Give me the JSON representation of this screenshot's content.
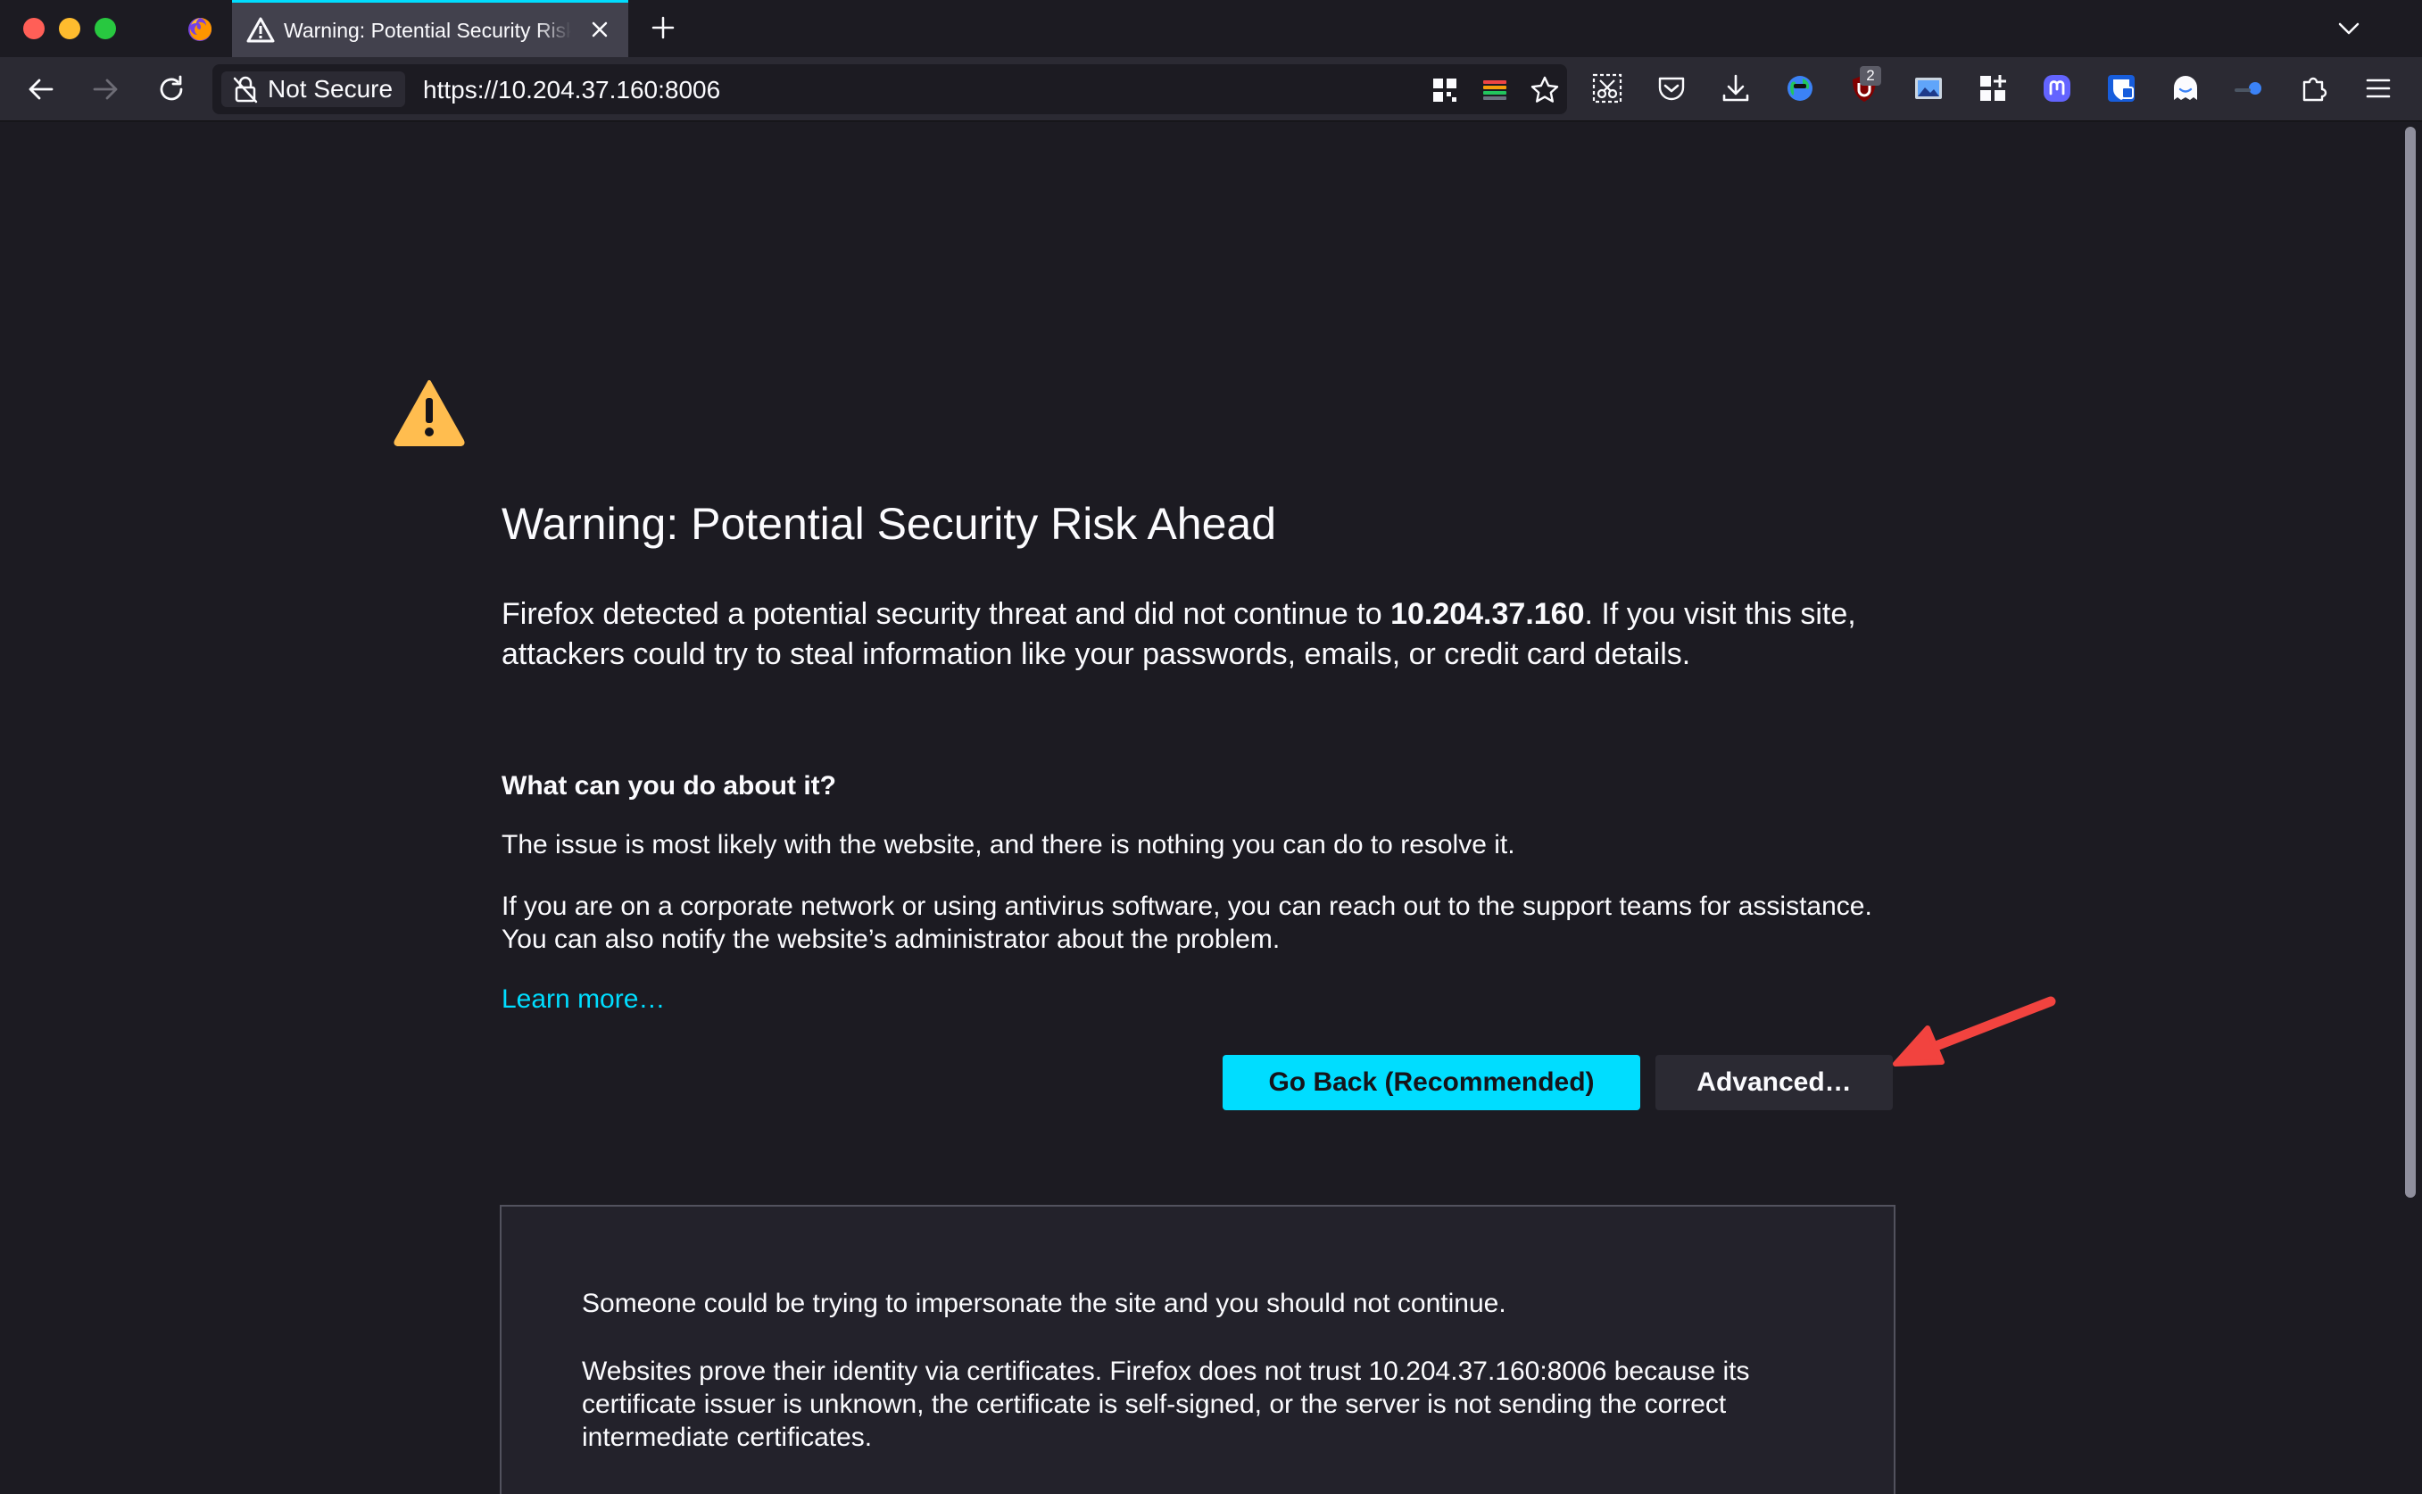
{
  "browser": {
    "tab": {
      "title": "Warning: Potential Security Risk Ahead"
    },
    "urlbar": {
      "security_label": "Not Secure",
      "url": "https://10.204.37.160:8006"
    },
    "toolbar": {
      "badge_count": "2"
    }
  },
  "page": {
    "title": "Warning: Potential Security Risk Ahead",
    "intro_before": "Firefox detected a potential security threat and did not continue to ",
    "intro_host": "10.204.37.160",
    "intro_after": ". If you visit this site, attackers could try to steal information like your passwords, emails, or credit card details.",
    "subheading": "What can you do about it?",
    "paragraph_1": "The issue is most likely with the website, and there is nothing you can do to resolve it.",
    "paragraph_2": "If you are on a corporate network or using antivirus software, you can reach out to the support teams for assistance. You can also notify the website’s administrator about the problem.",
    "learn_more": "Learn more…",
    "go_back_button": "Go Back (Recommended)",
    "advanced_button": "Advanced…",
    "advanced_panel": {
      "paragraph_1": "Someone could be trying to impersonate the site and you should not continue.",
      "paragraph_2": "Websites prove their identity via certificates. Firefox does not trust 10.204.37.160:8006 because its certificate issuer is unknown, the certificate is self-signed, or the server is not sending the correct intermediate certificates."
    }
  },
  "colors": {
    "accent": "#00ddff",
    "warning": "#ffbd4f",
    "annotation_arrow": "#f2433f",
    "background": "#1c1b22"
  }
}
